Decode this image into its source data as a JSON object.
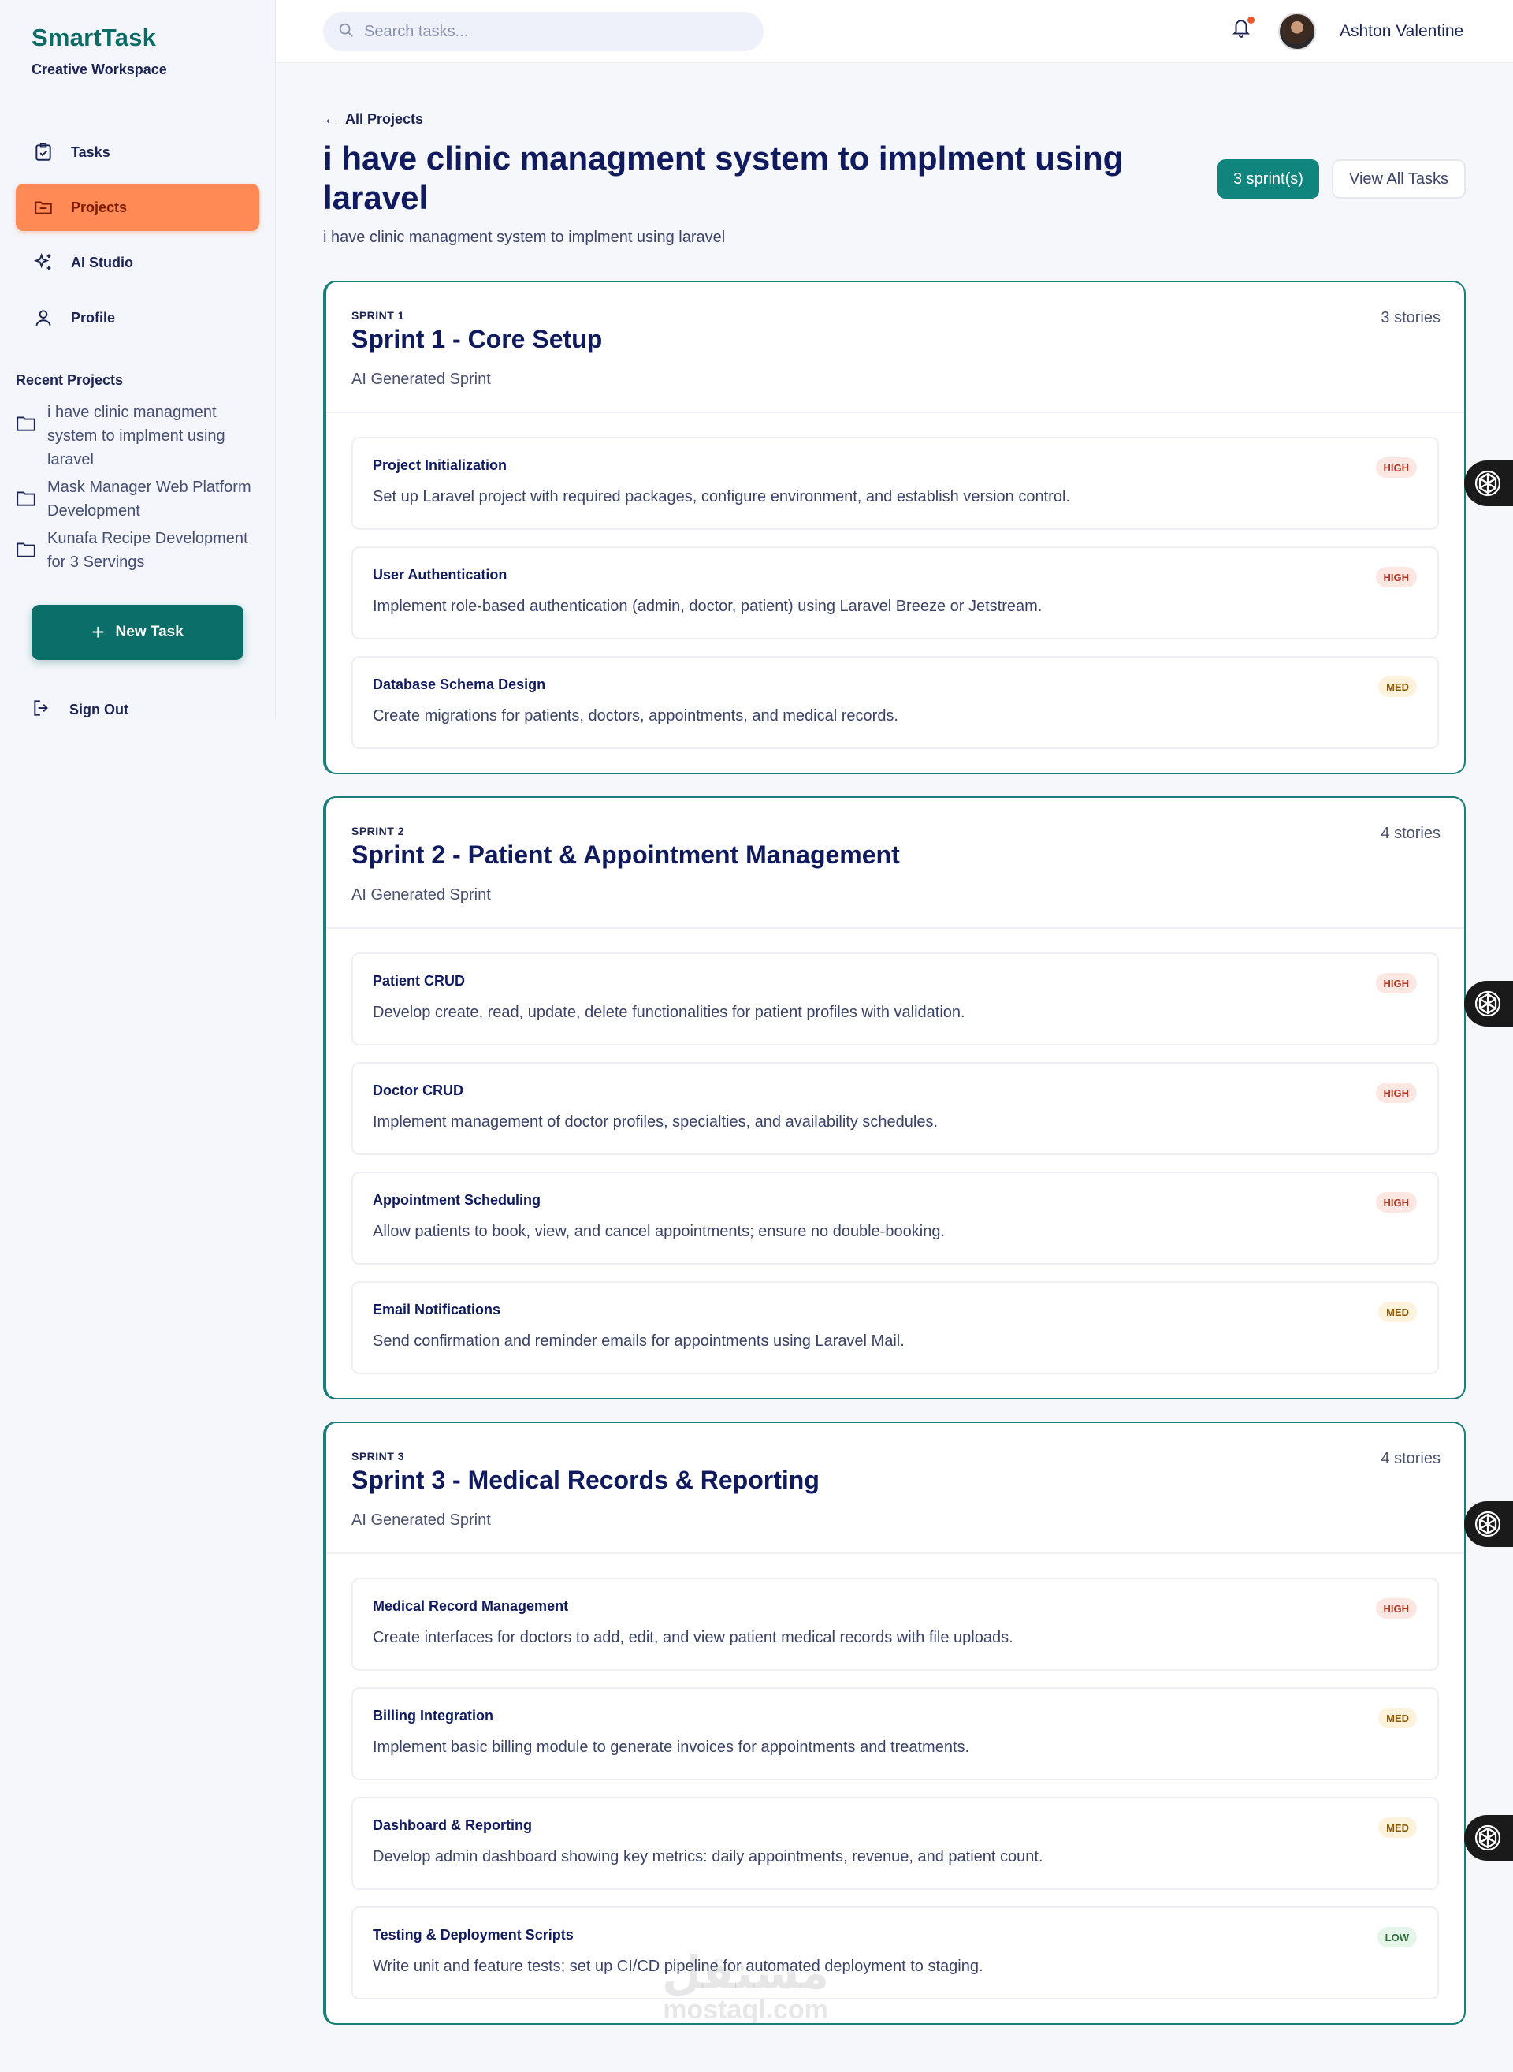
{
  "brand": {
    "title": "SmartTask",
    "subtitle": "Creative Workspace"
  },
  "nav": {
    "items": [
      {
        "label": "Tasks",
        "icon": "clipboard-check-icon"
      },
      {
        "label": "Projects",
        "icon": "folder-icon",
        "active": true
      },
      {
        "label": "AI Studio",
        "icon": "sparkles-icon"
      },
      {
        "label": "Profile",
        "icon": "user-icon"
      }
    ]
  },
  "recent": {
    "title": "Recent Projects",
    "items": [
      "i have clinic managment system to implment using laravel",
      "Mask Manager Web Platform Development",
      "Kunafa Recipe Development for 3 Servings"
    ]
  },
  "new_task_label": "New Task",
  "sign_out_label": "Sign Out",
  "search": {
    "placeholder": "Search tasks..."
  },
  "user": {
    "name": "Ashton Valentine"
  },
  "project": {
    "back_label": "All Projects",
    "title": "i have clinic managment system to implment using laravel",
    "subtitle": "i have clinic managment system to implment using laravel",
    "sprint_count_label": "3 sprint(s)",
    "view_all_label": "View All Tasks"
  },
  "sprints": [
    {
      "label": "SPRINT 1",
      "title": "Sprint 1 - Core Setup",
      "subtitle": "AI Generated Sprint",
      "stories": "3 stories",
      "tasks": [
        {
          "title": "Project Initialization",
          "desc": "Set up Laravel project with required packages, configure environment, and establish version control.",
          "priority": "HIGH"
        },
        {
          "title": "User Authentication",
          "desc": "Implement role-based authentication (admin, doctor, patient) using Laravel Breeze or Jetstream.",
          "priority": "HIGH"
        },
        {
          "title": "Database Schema Design",
          "desc": "Create migrations for patients, doctors, appointments, and medical records.",
          "priority": "MED"
        }
      ]
    },
    {
      "label": "SPRINT 2",
      "title": "Sprint 2 - Patient & Appointment Management",
      "subtitle": "AI Generated Sprint",
      "stories": "4 stories",
      "tasks": [
        {
          "title": "Patient CRUD",
          "desc": "Develop create, read, update, delete functionalities for patient profiles with validation.",
          "priority": "HIGH"
        },
        {
          "title": "Doctor CRUD",
          "desc": "Implement management of doctor profiles, specialties, and availability schedules.",
          "priority": "HIGH"
        },
        {
          "title": "Appointment Scheduling",
          "desc": "Allow patients to book, view, and cancel appointments; ensure no double-booking.",
          "priority": "HIGH"
        },
        {
          "title": "Email Notifications",
          "desc": "Send confirmation and reminder emails for appointments using Laravel Mail.",
          "priority": "MED"
        }
      ]
    },
    {
      "label": "SPRINT 3",
      "title": "Sprint 3 - Medical Records & Reporting",
      "subtitle": "AI Generated Sprint",
      "stories": "4 stories",
      "tasks": [
        {
          "title": "Medical Record Management",
          "desc": "Create interfaces for doctors to add, edit, and view patient medical records with file uploads.",
          "priority": "HIGH"
        },
        {
          "title": "Billing Integration",
          "desc": "Implement basic billing module to generate invoices for appointments and treatments.",
          "priority": "MED"
        },
        {
          "title": "Dashboard & Reporting",
          "desc": "Develop admin dashboard showing key metrics: daily appointments, revenue, and patient count.",
          "priority": "MED"
        },
        {
          "title": "Testing & Deployment Scripts",
          "desc": "Write unit and feature tests; set up CI/CD pipeline for automated deployment to staging.",
          "priority": "LOW"
        }
      ]
    }
  ],
  "watermark": {
    "arabic": "مستقل",
    "latin": "mostaql.com"
  },
  "colors": {
    "brand": "#0d6b66",
    "accent": "#ff8a55",
    "primary_button": "#0b6e69",
    "sprint_badge": "#0f857e",
    "title": "#101a5e"
  }
}
